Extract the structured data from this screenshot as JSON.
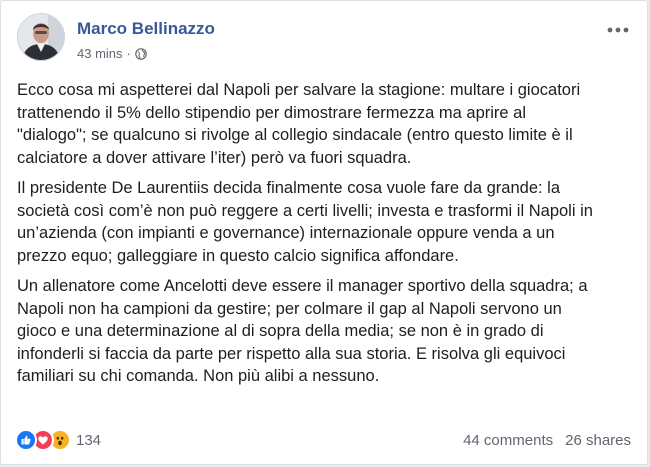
{
  "post": {
    "author": "Marco Bellinazzo",
    "timestamp": "43 mins",
    "separator": "·",
    "privacy_icon": "globe-icon",
    "more_icon": "more-horizontal-icon",
    "paragraphs": [
      "Ecco cosa mi aspetterei dal Napoli per salvare la stagione: multare i giocatori\ntrattenendo il 5% dello stipendio per dimostrare fermezza ma aprire al\n\"dialogo\"; se qualcuno si rivolge al collegio sindacale (entro questo limite è il\ncalciatore a dover attivare l’iter) però va fuori squadra.",
      "Il presidente De Laurentiis decida finalmente cosa vuole fare da grande: la\nsocietà così com’è non può reggere a certi livelli; investa e trasformi il Napoli in\nun’azienda (con impianti e governance) internazionale oppure venda a un\nprezzo equo; galleggiare in questo calcio significa affondare.",
      "Un allenatore come Ancelotti deve essere il manager sportivo della squadra; a\nNapoli non ha campioni da gestire; per colmare il gap al Napoli servono un\ngioco e una determinazione al di sopra della media; se non è in grado di\ninfonderli si faccia da parte per rispetto alla sua storia. E risolva gli equivoci\nfamiliari su chi comanda. Non più alibi a nessuno."
    ]
  },
  "footer": {
    "reactions": [
      "like-icon",
      "love-icon",
      "wow-icon"
    ],
    "reaction_count": "134",
    "comments": "44 comments",
    "shares": "26 shares"
  },
  "colors": {
    "author": "#385898",
    "like": "#1877f2",
    "love": "#f33e58",
    "wow": "#f7b125"
  }
}
